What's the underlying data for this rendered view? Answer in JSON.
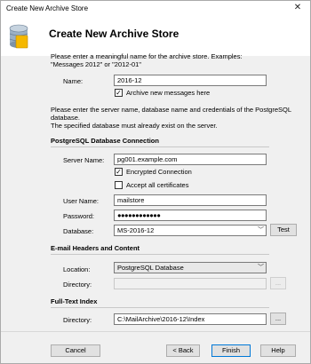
{
  "window": {
    "title": "Create New Archive Store",
    "close_glyph": "✕"
  },
  "header": {
    "title": "Create New Archive Store"
  },
  "intro": {
    "line1": "Please enter a meaningful name for the archive store. Examples:",
    "line2": "\"Messages 2012\" or \"2012-01\""
  },
  "name": {
    "label": "Name:",
    "value": "2016-12",
    "archive_new_label": "Archive new messages here",
    "archive_new_checked": true
  },
  "db_intro": {
    "line1": "Please enter the server name, database name and credentials of the PostgreSQL database.",
    "line2": "The specified database must already exist on the server."
  },
  "postgres": {
    "section_title": "PostgreSQL Database Connection",
    "server_label": "Server Name:",
    "server_value": "pg001.example.com",
    "encrypted_label": "Encrypted Connection",
    "encrypted_checked": true,
    "accept_label": "Accept all certificates",
    "accept_checked": false,
    "user_label": "User Name:",
    "user_value": "mailstore",
    "password_label": "Password:",
    "password_value": "●●●●●●●●●●●●",
    "database_label": "Database:",
    "database_value": "MS-2016-12",
    "test_button": "Test"
  },
  "email_headers": {
    "section_title": "E-mail Headers and Content",
    "location_label": "Location:",
    "location_value": "PostgreSQL Database",
    "directory_label": "Directory:",
    "directory_value": "",
    "browse_button": "..."
  },
  "fulltext": {
    "section_title": "Full-Text Index",
    "directory_label": "Directory:",
    "directory_value": "C:\\MailArchive\\2016-12\\Index",
    "browse_button": "..."
  },
  "footer": {
    "cancel": "Cancel",
    "back": "< Back",
    "finish": "Finish",
    "help": "Help"
  },
  "icons": {
    "logo": "database-icon",
    "chevron": "chevron-down-icon",
    "check": "✓"
  }
}
